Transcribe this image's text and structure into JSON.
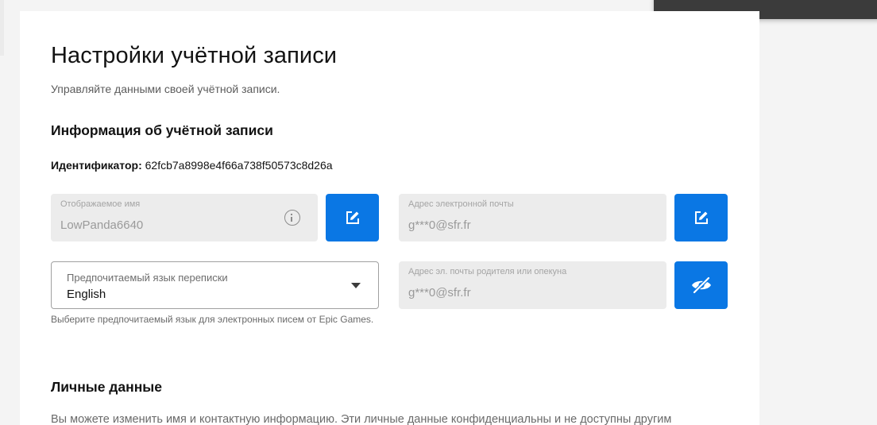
{
  "page": {
    "title": "Настройки учётной записи",
    "subtitle": "Управляйте данными своей учётной записи."
  },
  "account_info": {
    "section_title": "Информация об учётной записи",
    "identifier_label": "Идентификатор:",
    "identifier_value": "62fcb7a8998e4f66a738f50573c8d26a",
    "display_name": {
      "label": "Отображаемое имя",
      "value": "LowPanda6640"
    },
    "email": {
      "label": "Адрес электронной почты",
      "value": "g***0@sfr.fr"
    },
    "language": {
      "label": "Предпочитаемый язык переписки",
      "value": "English",
      "helper": "Выберите предпочитаемый язык для электронных писем от Epic Games."
    },
    "parent_email": {
      "label": "Адрес эл. почты родителя или опекуна",
      "value": "g***0@sfr.fr"
    }
  },
  "personal": {
    "section_title": "Личные данные",
    "description": "Вы можете изменить имя и контактную информацию. Эти личные данные конфиденциальны и не доступны другим"
  },
  "colors": {
    "accent": "#0a77e4",
    "field_bg": "#ececec",
    "popup_bg": "#3b3b3b"
  },
  "icons": {
    "edit": "edit-icon",
    "info": "info-icon",
    "reveal": "eye-slash-icon",
    "dropdown": "chevron-down-icon"
  }
}
